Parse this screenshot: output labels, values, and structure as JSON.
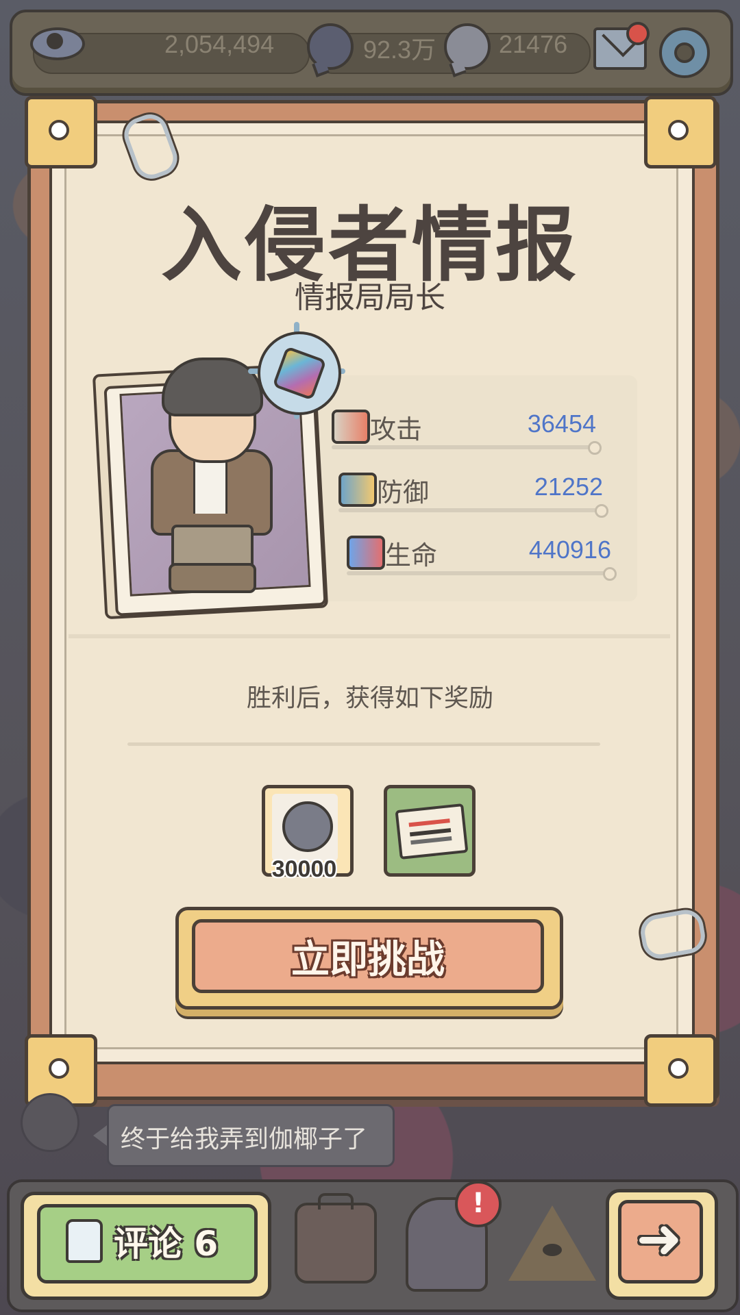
{
  "top_bar": {
    "views_count": "2,054,494",
    "coin_dark_count": "92.3万",
    "coin_light_count": "21476"
  },
  "panel": {
    "title": "入侵者情报",
    "subtitle": "情报局局长",
    "stats": {
      "attack": {
        "label": "攻击",
        "value": "36454"
      },
      "defense": {
        "label": "防御",
        "value": "21252"
      },
      "life": {
        "label": "生命",
        "value": "440916"
      }
    },
    "reward_text": "胜利后，获得如下奖励",
    "rewards": {
      "coin_amount": "30000"
    },
    "challenge_label": "立即挑战"
  },
  "speech_bubble": {
    "text": "终于给我弄到伽椰子了"
  },
  "bottom_bar": {
    "comment_label": "评论 6",
    "alert_glyph": "!",
    "next_glyph": "➜"
  },
  "colors": {
    "stat_value": "#4f75c8",
    "button_accent": "#ecab8c",
    "comment_green": "#a6cf86",
    "paper": "#f4ead8"
  }
}
